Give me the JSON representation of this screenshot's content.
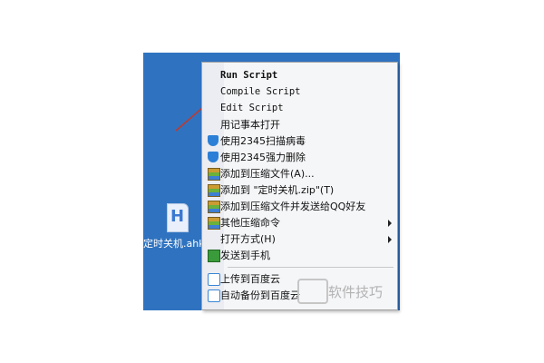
{
  "desktop": {
    "file_label": "定时关机.ahk",
    "file_icon_letter": "H"
  },
  "context_menu": {
    "items": [
      {
        "label": "Run Script",
        "icon": ""
      },
      {
        "label": "Compile Script",
        "icon": ""
      },
      {
        "label": "Edit Script",
        "icon": ""
      },
      {
        "label": "用记事本打开",
        "icon": ""
      },
      {
        "label": "使用2345扫描病毒",
        "icon": "shield-icon"
      },
      {
        "label": "使用2345强力删除",
        "icon": "shield-icon"
      },
      {
        "label": "添加到压缩文件(A)...",
        "icon": "archive-icon"
      },
      {
        "label": "添加到 \"定时关机.zip\"(T)",
        "icon": "archive-icon"
      },
      {
        "label": "添加到压缩文件并发送给QQ好友",
        "icon": "archive-icon"
      },
      {
        "label": "其他压缩命令",
        "icon": "archive-icon"
      },
      {
        "label": "打开方式(H)",
        "icon": ""
      },
      {
        "label": "发送到手机",
        "icon": "phone-icon"
      },
      {
        "label": "上传到百度云",
        "icon": "cloud-icon"
      },
      {
        "label": "自动备份到百度云",
        "icon": "cloud-icon"
      }
    ]
  },
  "watermark": {
    "text": "软件技巧"
  },
  "colors": {
    "desktop_bg": "#2f73c0",
    "menu_bg": "#f5f6f8",
    "arrow": "#c0392b"
  }
}
